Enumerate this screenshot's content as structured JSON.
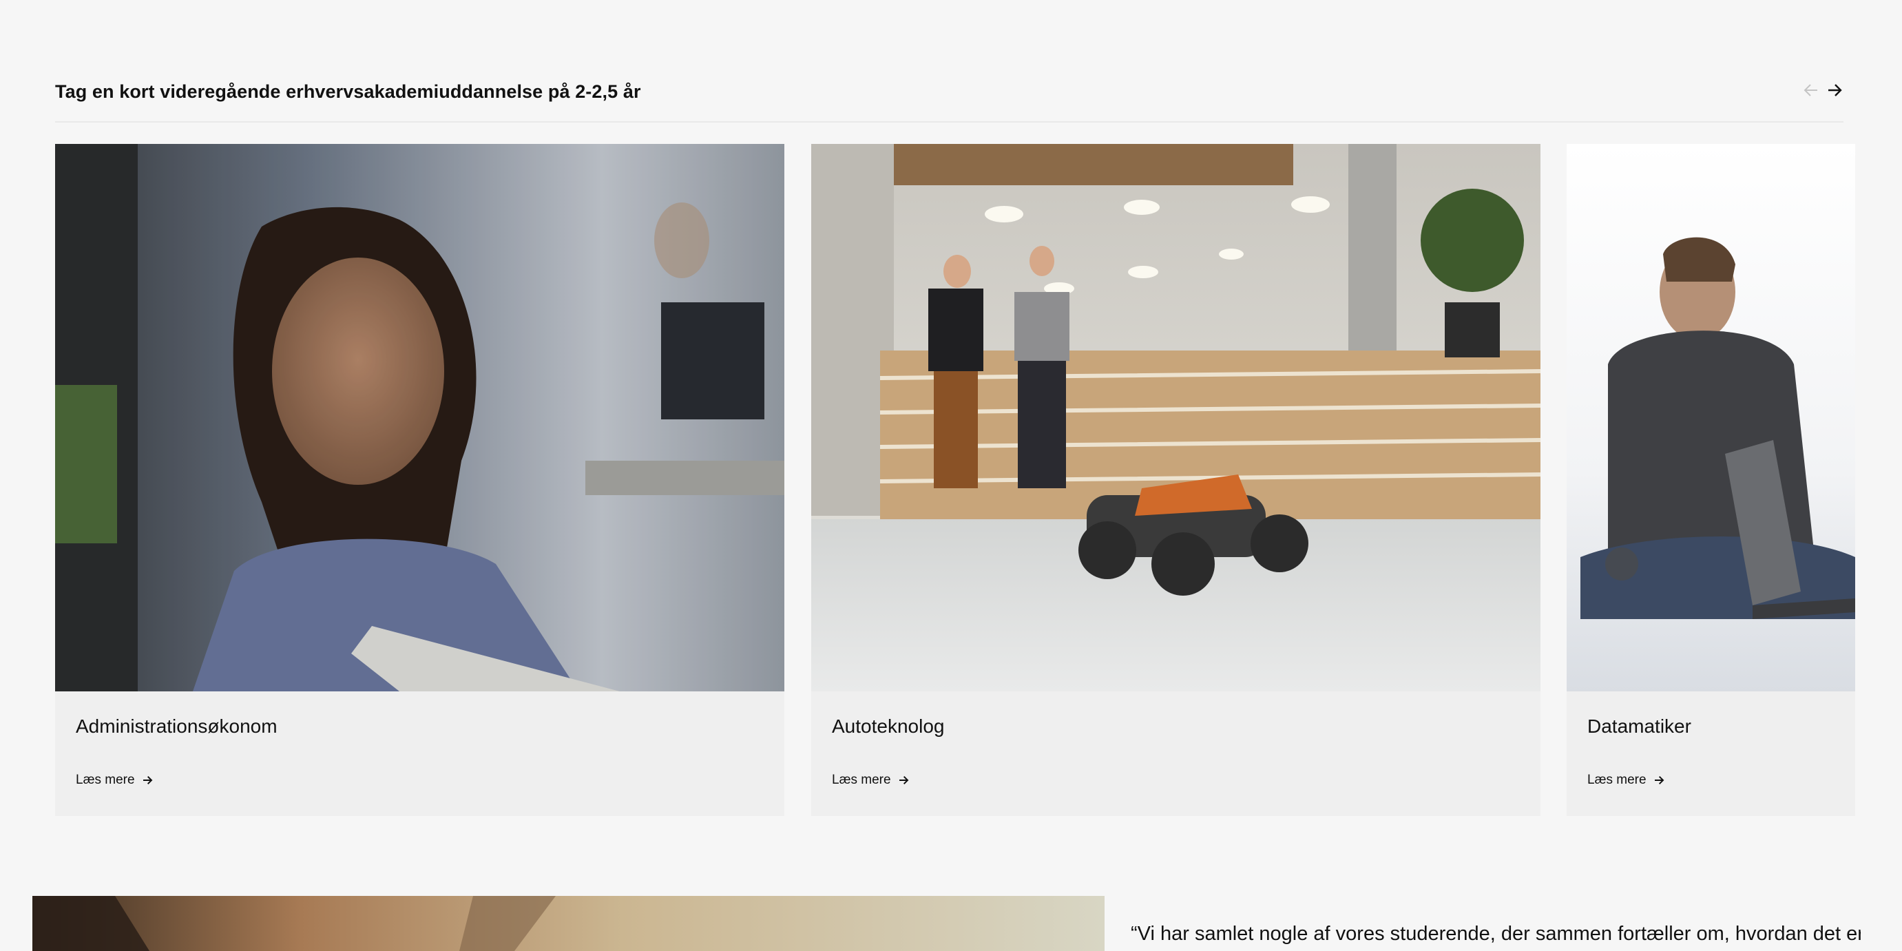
{
  "section": {
    "title": "Tag en kort videregående erhvervsakademiuddannelse på 2-2,5 år",
    "prev_icon": "arrow-left-icon",
    "next_icon": "arrow-right-icon"
  },
  "cards": [
    {
      "title": "Administrationsøkonom",
      "link_label": "Læs mere",
      "link_icon": "arrow-right-icon"
    },
    {
      "title": "Autoteknolog",
      "link_label": "Læs mere",
      "link_icon": "arrow-right-icon"
    },
    {
      "title": "Datamatiker",
      "link_label": "Læs mere",
      "link_icon": "arrow-right-icon"
    }
  ],
  "quote": {
    "text": "“Vi har samlet nogle af vores studerende, der sammen fortæller om, hvordan det er at gå"
  },
  "colors": {
    "background": "#f6f6f6",
    "card_background": "#efefef",
    "text": "#111111",
    "arrow_disabled": "#bdbdbd"
  }
}
